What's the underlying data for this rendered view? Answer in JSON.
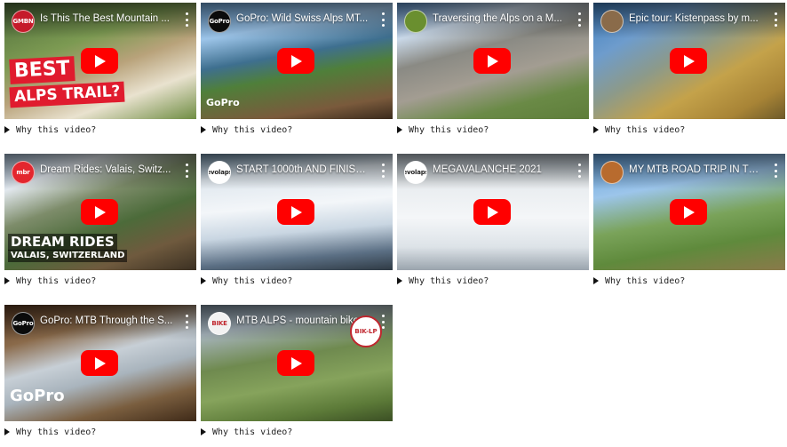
{
  "why_label": "Why this video?",
  "videos": [
    {
      "title": "Is This The Best Mountain ...",
      "channel": "GMBN",
      "overlay1": "BEST",
      "overlay2": "ALPS TRAIL?",
      "play_icon": "youtube-play-icon"
    },
    {
      "title": "GoPro: Wild Swiss Alps MT...",
      "channel": "GoPro",
      "badge": "GoPro"
    },
    {
      "title": "Traversing the Alps on a M...",
      "channel": ""
    },
    {
      "title": "Epic tour: Kistenpass by m...",
      "channel": ""
    },
    {
      "title": "Dream Rides: Valais, Switz...",
      "channel": "mbr",
      "overlay1": "DREAM RIDES",
      "overlay2": "VALAIS, SWITZERLAND"
    },
    {
      "title": "START 1000th AND FINISH ...",
      "channel": "evolaps"
    },
    {
      "title": "MEGAVALANCHE 2021",
      "channel": "evolaps"
    },
    {
      "title": "MY MTB ROAD TRIP IN TH...",
      "channel": ""
    },
    {
      "title": "GoPro: MTB Through the S...",
      "channel": "GoPro",
      "badge": "GoPro"
    },
    {
      "title": "MTB ALPS - mountain bike ...",
      "channel": "BIKE",
      "badge": "BIK-LP"
    }
  ],
  "colors": {
    "play": "#ff0000",
    "text": "#222222"
  }
}
